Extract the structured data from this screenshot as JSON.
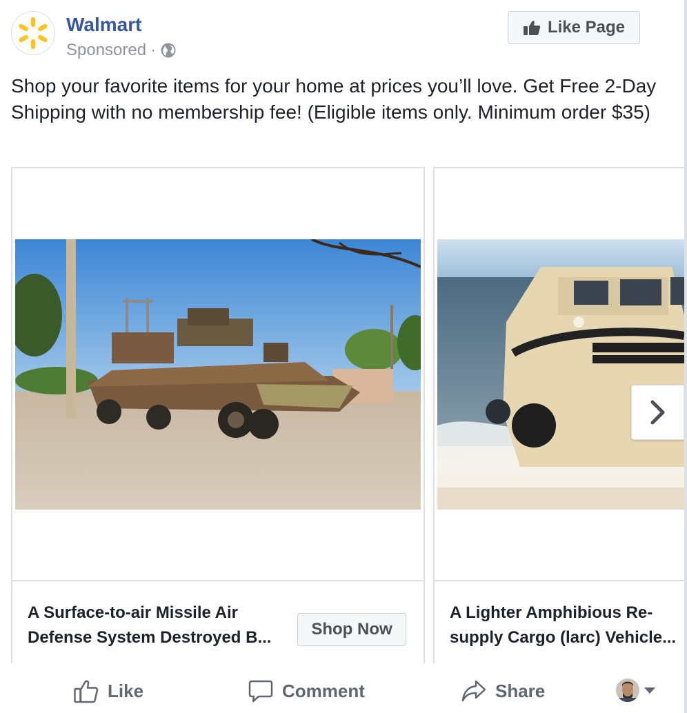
{
  "post": {
    "page_name": "Walmart",
    "sponsored_label": "Sponsored",
    "separator": "·",
    "audience_icon": "globe-icon",
    "like_page_label": "Like Page",
    "message": "Shop your favorite items for your home at prices you’ll love. Get Free 2-Day Shipping with no membership fee! (Eligible items only. Minimum order $35)"
  },
  "carousel": {
    "cards": [
      {
        "title_line1": "A Surface-to-air Missile Air",
        "title_line2": "Defense System Destroyed B...",
        "cta_label": "Shop Now",
        "image": "destroyed-military-vehicle-photo"
      },
      {
        "title_line1": "A Lighter Amphibious Re-",
        "title_line2": "supply Cargo (larc) Vehicle...",
        "image": "amphibious-vehicle-photo"
      }
    ],
    "next_icon": "chevron-right-icon"
  },
  "actions": {
    "like_label": "Like",
    "comment_label": "Comment",
    "share_label": "Share"
  },
  "colors": {
    "brand_blue": "#365899",
    "walmart_spark": "#FFC220",
    "text": "#1d2129",
    "muted": "#90949c",
    "border": "#dddfe2"
  }
}
